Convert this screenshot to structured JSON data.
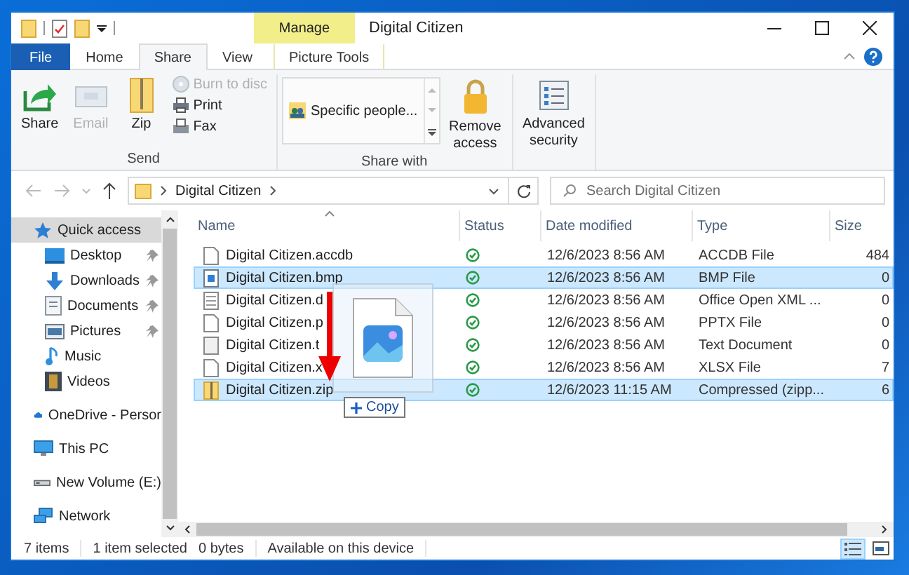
{
  "window": {
    "title": "Digital Citizen"
  },
  "contextual_tab": {
    "group": "Manage",
    "label": "Picture Tools"
  },
  "tabs": [
    {
      "label": "File",
      "kind": "file",
      "selected": false
    },
    {
      "label": "Home",
      "kind": "normal",
      "selected": false
    },
    {
      "label": "Share",
      "kind": "normal",
      "selected": true
    },
    {
      "label": "View",
      "kind": "normal",
      "selected": false
    }
  ],
  "ribbon": {
    "send": {
      "label": "Send",
      "share": {
        "label": "Share",
        "disabled": false
      },
      "email": {
        "label": "Email",
        "disabled": true
      },
      "zip": {
        "label": "Zip",
        "disabled": false
      },
      "burn_to_disc": {
        "label": "Burn to disc",
        "disabled": true
      },
      "print": {
        "label": "Print",
        "disabled": false
      },
      "fax": {
        "label": "Fax",
        "disabled": false
      }
    },
    "share_with": {
      "label": "Share with",
      "gallery_item": "Specific people...",
      "remove_access": {
        "label": "Remove access",
        "disabled": false
      }
    },
    "advanced_security": {
      "label": "Advanced security"
    }
  },
  "address_bar": {
    "path": [
      "Digital Citizen"
    ]
  },
  "search": {
    "placeholder": "Search Digital Citizen"
  },
  "navigation": [
    {
      "label": "Quick access",
      "kind": "star",
      "selected": true,
      "children": [
        {
          "label": "Desktop",
          "kind": "desktop",
          "pinned": true,
          "selected": false
        },
        {
          "label": "Downloads",
          "kind": "downloads",
          "pinned": true,
          "selected": false
        },
        {
          "label": "Documents",
          "kind": "documents",
          "pinned": true,
          "selected": false
        },
        {
          "label": "Pictures",
          "kind": "pictures",
          "pinned": true,
          "selected": false
        },
        {
          "label": "Music",
          "kind": "music",
          "pinned": false,
          "selected": false
        },
        {
          "label": "Videos",
          "kind": "videos",
          "pinned": false,
          "selected": false
        }
      ]
    },
    {
      "label": "OneDrive - Persor",
      "kind": "cloud",
      "selected": false
    },
    {
      "label": "This PC",
      "kind": "pc",
      "selected": false
    },
    {
      "label": "New Volume (E:)",
      "kind": "drive",
      "selected": false
    },
    {
      "label": "Network",
      "kind": "network",
      "selected": false
    }
  ],
  "files": {
    "columns": [
      "Name",
      "Status",
      "Date modified",
      "Type",
      "Size"
    ],
    "rows": [
      {
        "name": "Digital Citizen.accdb",
        "kind": "blank",
        "date": "12/6/2023 8:56 AM",
        "type": "ACCDB File",
        "size": "484",
        "selected": false
      },
      {
        "name": "Digital Citizen.bmp",
        "kind": "image",
        "date": "12/6/2023 8:56 AM",
        "type": "BMP File",
        "size": "0",
        "selected": true
      },
      {
        "name": "Digital Citizen.d",
        "kind": "document",
        "date": "12/6/2023 8:56 AM",
        "type": "Office Open XML ...",
        "size": "0",
        "selected": false
      },
      {
        "name": "Digital Citizen.p",
        "kind": "blank",
        "date": "12/6/2023 8:56 AM",
        "type": "PPTX File",
        "size": "0",
        "selected": false
      },
      {
        "name": "Digital Citizen.t",
        "kind": "text",
        "date": "12/6/2023 8:56 AM",
        "type": "Text Document",
        "size": "0",
        "selected": false
      },
      {
        "name": "Digital Citizen.x",
        "kind": "blank",
        "date": "12/6/2023 8:56 AM",
        "type": "XLSX File",
        "size": "7",
        "selected": false
      },
      {
        "name": "Digital Citizen.zip",
        "kind": "zip",
        "date": "12/6/2023 11:15 AM",
        "type": "Compressed (zipp...",
        "size": "6",
        "selected": true
      }
    ]
  },
  "drag": {
    "effect": "Copy"
  },
  "status_bar": {
    "item_count": "7 items",
    "selection": "1 item selected",
    "size": "0 bytes",
    "availability": "Available on this device",
    "views": [
      {
        "kind": "details",
        "selected": true
      },
      {
        "kind": "large_icons",
        "selected": false
      }
    ]
  }
}
